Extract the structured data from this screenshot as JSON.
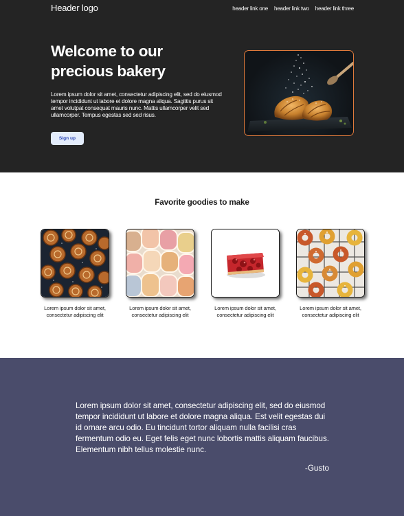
{
  "colors": {
    "hero_bg": "#242424",
    "quote_bg": "#4a4c6b",
    "accent_border": "#e07a3b",
    "button_bg": "#e3ecfb",
    "button_text": "#2a46b4"
  },
  "header": {
    "logo": "Header logo",
    "links": [
      "header link one",
      "header link two",
      "header link three"
    ]
  },
  "hero": {
    "title": "Welcome to our precious bakery",
    "text": "Lorem ipsum dolor sit amet, consectetur adipiscing elit, sed do eiusmod tempor incididunt ut labore et dolore magna aliqua. Sagittis purus sit amet volutpat consequat mauris nunc. Mattis ullamcorper velit sed ullamcorper. Tempus egestas sed sed risus.",
    "button_label": "Sign up",
    "image": "croissants-photo"
  },
  "goodies": {
    "title": "Favorite goodies to make",
    "items": [
      {
        "image": "cinnamon-rolls-photo",
        "caption": "Lorem ipsum dolor sit amet, consectetur adipiscing elit"
      },
      {
        "image": "macarons-photo",
        "caption": "Lorem ipsum dolor sit amet, consectetur adipiscing elit"
      },
      {
        "image": "strawberry-cake-photo",
        "caption": "Lorem ipsum dolor sit amet, consectetur adipiscing elit"
      },
      {
        "image": "donuts-photo",
        "caption": "Lorem ipsum dolor sit amet, consectetur adipiscing elit"
      }
    ]
  },
  "quote": {
    "text": "Lorem ipsum dolor sit amet, consectetur adipiscing elit, sed do eiusmod tempor incididunt ut labore et dolore magna aliqua. Est velit egestas dui id ornare arcu odio. Eu tincidunt tortor aliquam nulla facilisi cras fermentum odio eu. Eget felis eget nunc lobortis mattis aliquam faucibus. Elementum nibh tellus molestie nunc.",
    "author": "-Gusto"
  }
}
